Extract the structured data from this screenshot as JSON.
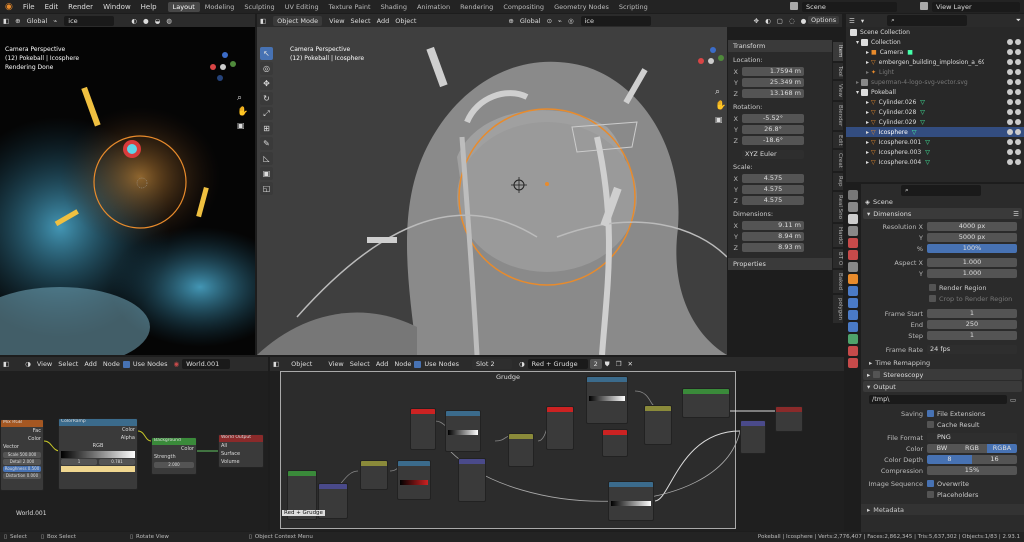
{
  "topbar": {
    "menus": [
      "File",
      "Edit",
      "Render",
      "Window",
      "Help"
    ],
    "workspaces": [
      "Layout",
      "Modeling",
      "Sculpting",
      "UV Editing",
      "Texture Paint",
      "Shading",
      "Animation",
      "Rendering",
      "Compositing",
      "Geometry Nodes",
      "Scripting"
    ],
    "scene": "Scene",
    "view_layer": "View Layer"
  },
  "left_view": {
    "global": "Global",
    "search": "ice",
    "camera_line": "Camera Perspective",
    "object_line": "(12) Pokeball | Icosphere",
    "status_line": "Rendering Done"
  },
  "main_view": {
    "mode": "Object Mode",
    "menus": [
      "View",
      "Select",
      "Add",
      "Object"
    ],
    "global": "Global",
    "search": "ice",
    "options": "Options",
    "camera_line": "Camera Perspective",
    "object_line": "(12) Pokeball | Icosphere"
  },
  "npanel": {
    "transform": "Transform",
    "location": "Location:",
    "loc": [
      {
        "axis": "X",
        "val": "1.7594 m"
      },
      {
        "axis": "Y",
        "val": "25.349 m"
      },
      {
        "axis": "Z",
        "val": "13.168 m"
      }
    ],
    "rotation": "Rotation:",
    "rot": [
      {
        "axis": "X",
        "val": "-5.52°"
      },
      {
        "axis": "Y",
        "val": "26.8°"
      },
      {
        "axis": "Z",
        "val": "-18.6°"
      }
    ],
    "euler": "XYZ Euler",
    "scale": "Scale:",
    "scl": [
      {
        "axis": "X",
        "val": "4.575"
      },
      {
        "axis": "Y",
        "val": "4.575"
      },
      {
        "axis": "Z",
        "val": "4.575"
      }
    ],
    "dimensions": "Dimensions:",
    "dim": [
      {
        "axis": "X",
        "val": "9.11 m"
      },
      {
        "axis": "Y",
        "val": "8.94 m"
      },
      {
        "axis": "Z",
        "val": "8.93 m"
      }
    ],
    "properties": "Properties",
    "tabs": [
      "Item",
      "Tool",
      "View",
      "Blender",
      "Edit",
      "Creat",
      "Rep",
      "Real Sno",
      "HardO",
      "BT O",
      "Baked",
      "polygon"
    ]
  },
  "outliner": {
    "items": [
      {
        "label": "Scene Collection"
      },
      {
        "label": "Collection"
      },
      {
        "label": "Camera"
      },
      {
        "label": "embergen_building_implosion_a_69"
      },
      {
        "label": "Light"
      },
      {
        "label": "superman-4-logo-svg-vector.svg"
      },
      {
        "label": "Pokeball"
      },
      {
        "label": "Cylinder.026"
      },
      {
        "label": "Cylinder.028"
      },
      {
        "label": "Cylinder.029"
      },
      {
        "label": "Icosphere"
      },
      {
        "label": "Icosphere.001"
      },
      {
        "label": "Icosphere.003"
      },
      {
        "label": "Icosphere.004"
      }
    ]
  },
  "props": {
    "scene": "Scene",
    "dimensions": "Dimensions",
    "res_x_label": "Resolution X",
    "res_x": "4000 px",
    "res_y_label": "Y",
    "res_y": "5000 px",
    "pct_label": "%",
    "pct": "100%",
    "aspect_x_label": "Aspect X",
    "aspect_x": "1.000",
    "aspect_y_label": "Y",
    "aspect_y": "1.000",
    "render_region": "Render Region",
    "crop": "Crop to Render Region",
    "fs_label": "Frame Start",
    "fs": "1",
    "end_label": "End",
    "end": "250",
    "step_label": "Step",
    "step": "1",
    "fr_label": "Frame Rate",
    "fr": "24 fps",
    "time_remap": "Time Remapping",
    "stereo": "Stereoscopy",
    "output": "Output",
    "path": "/tmp\\",
    "saving_label": "Saving",
    "file_ext": "File Extensions",
    "cache": "Cache Result",
    "ff_label": "File Format",
    "ff": "PNG",
    "color_label": "Color",
    "color_opts": [
      "BW",
      "RGB",
      "RGBA"
    ],
    "cd_label": "Color Depth",
    "cd_opts": [
      "8",
      "16"
    ],
    "comp_label": "Compression",
    "comp": "15%",
    "seq_label": "Image Sequence",
    "overwrite": "Overwrite",
    "placeholders": "Placeholders",
    "metadata": "Metadata"
  },
  "world_nodes": {
    "menus": [
      "View",
      "Select",
      "Add",
      "Node"
    ],
    "use_nodes": "Use Nodes",
    "world": "World.001",
    "label": "World.001",
    "n1_title": "Mix RGB",
    "n1_rows": [
      "Fac",
      "Color",
      "Vector"
    ],
    "n1_fields": [
      "Scale 500.000",
      "Detail 2.000",
      "Roughness 0.500",
      "Distortion 0.000"
    ],
    "n2_title": "ColorRamp",
    "n2_rows": [
      "Color",
      "Alpha"
    ],
    "n2_mode": "RGB",
    "n2_pos": "1",
    "n2_val": "0.781",
    "n3_title": "Background",
    "n3_rows": [
      "Background",
      "Color",
      "Strength"
    ],
    "n3_strength": "2.000",
    "n4_title": "World Output",
    "n4_rows": [
      "All",
      "Surface",
      "Volume"
    ]
  },
  "shader_nodes": {
    "object": "Object",
    "menus": [
      "View",
      "Select",
      "Add",
      "Node"
    ],
    "use_nodes": "Use Nodes",
    "slot": "Slot 2",
    "material": "Red + Grudge",
    "users": "2",
    "frame_title": "Grudge",
    "frame_label": "Red + Grudge"
  },
  "status": {
    "select": "Select",
    "box_select": "Box Select",
    "rotate": "Rotate View",
    "context": "Object Context Menu",
    "stats": "Pokeball | Icosphere | Verts:2,776,407 | Faces:2,862,345 | Tris:5,637,302 | Objects:1/83 | 2.93.1"
  },
  "colors": {
    "accent": "#4772b3",
    "orange": "#e88b2c",
    "selection": "#334d80"
  }
}
